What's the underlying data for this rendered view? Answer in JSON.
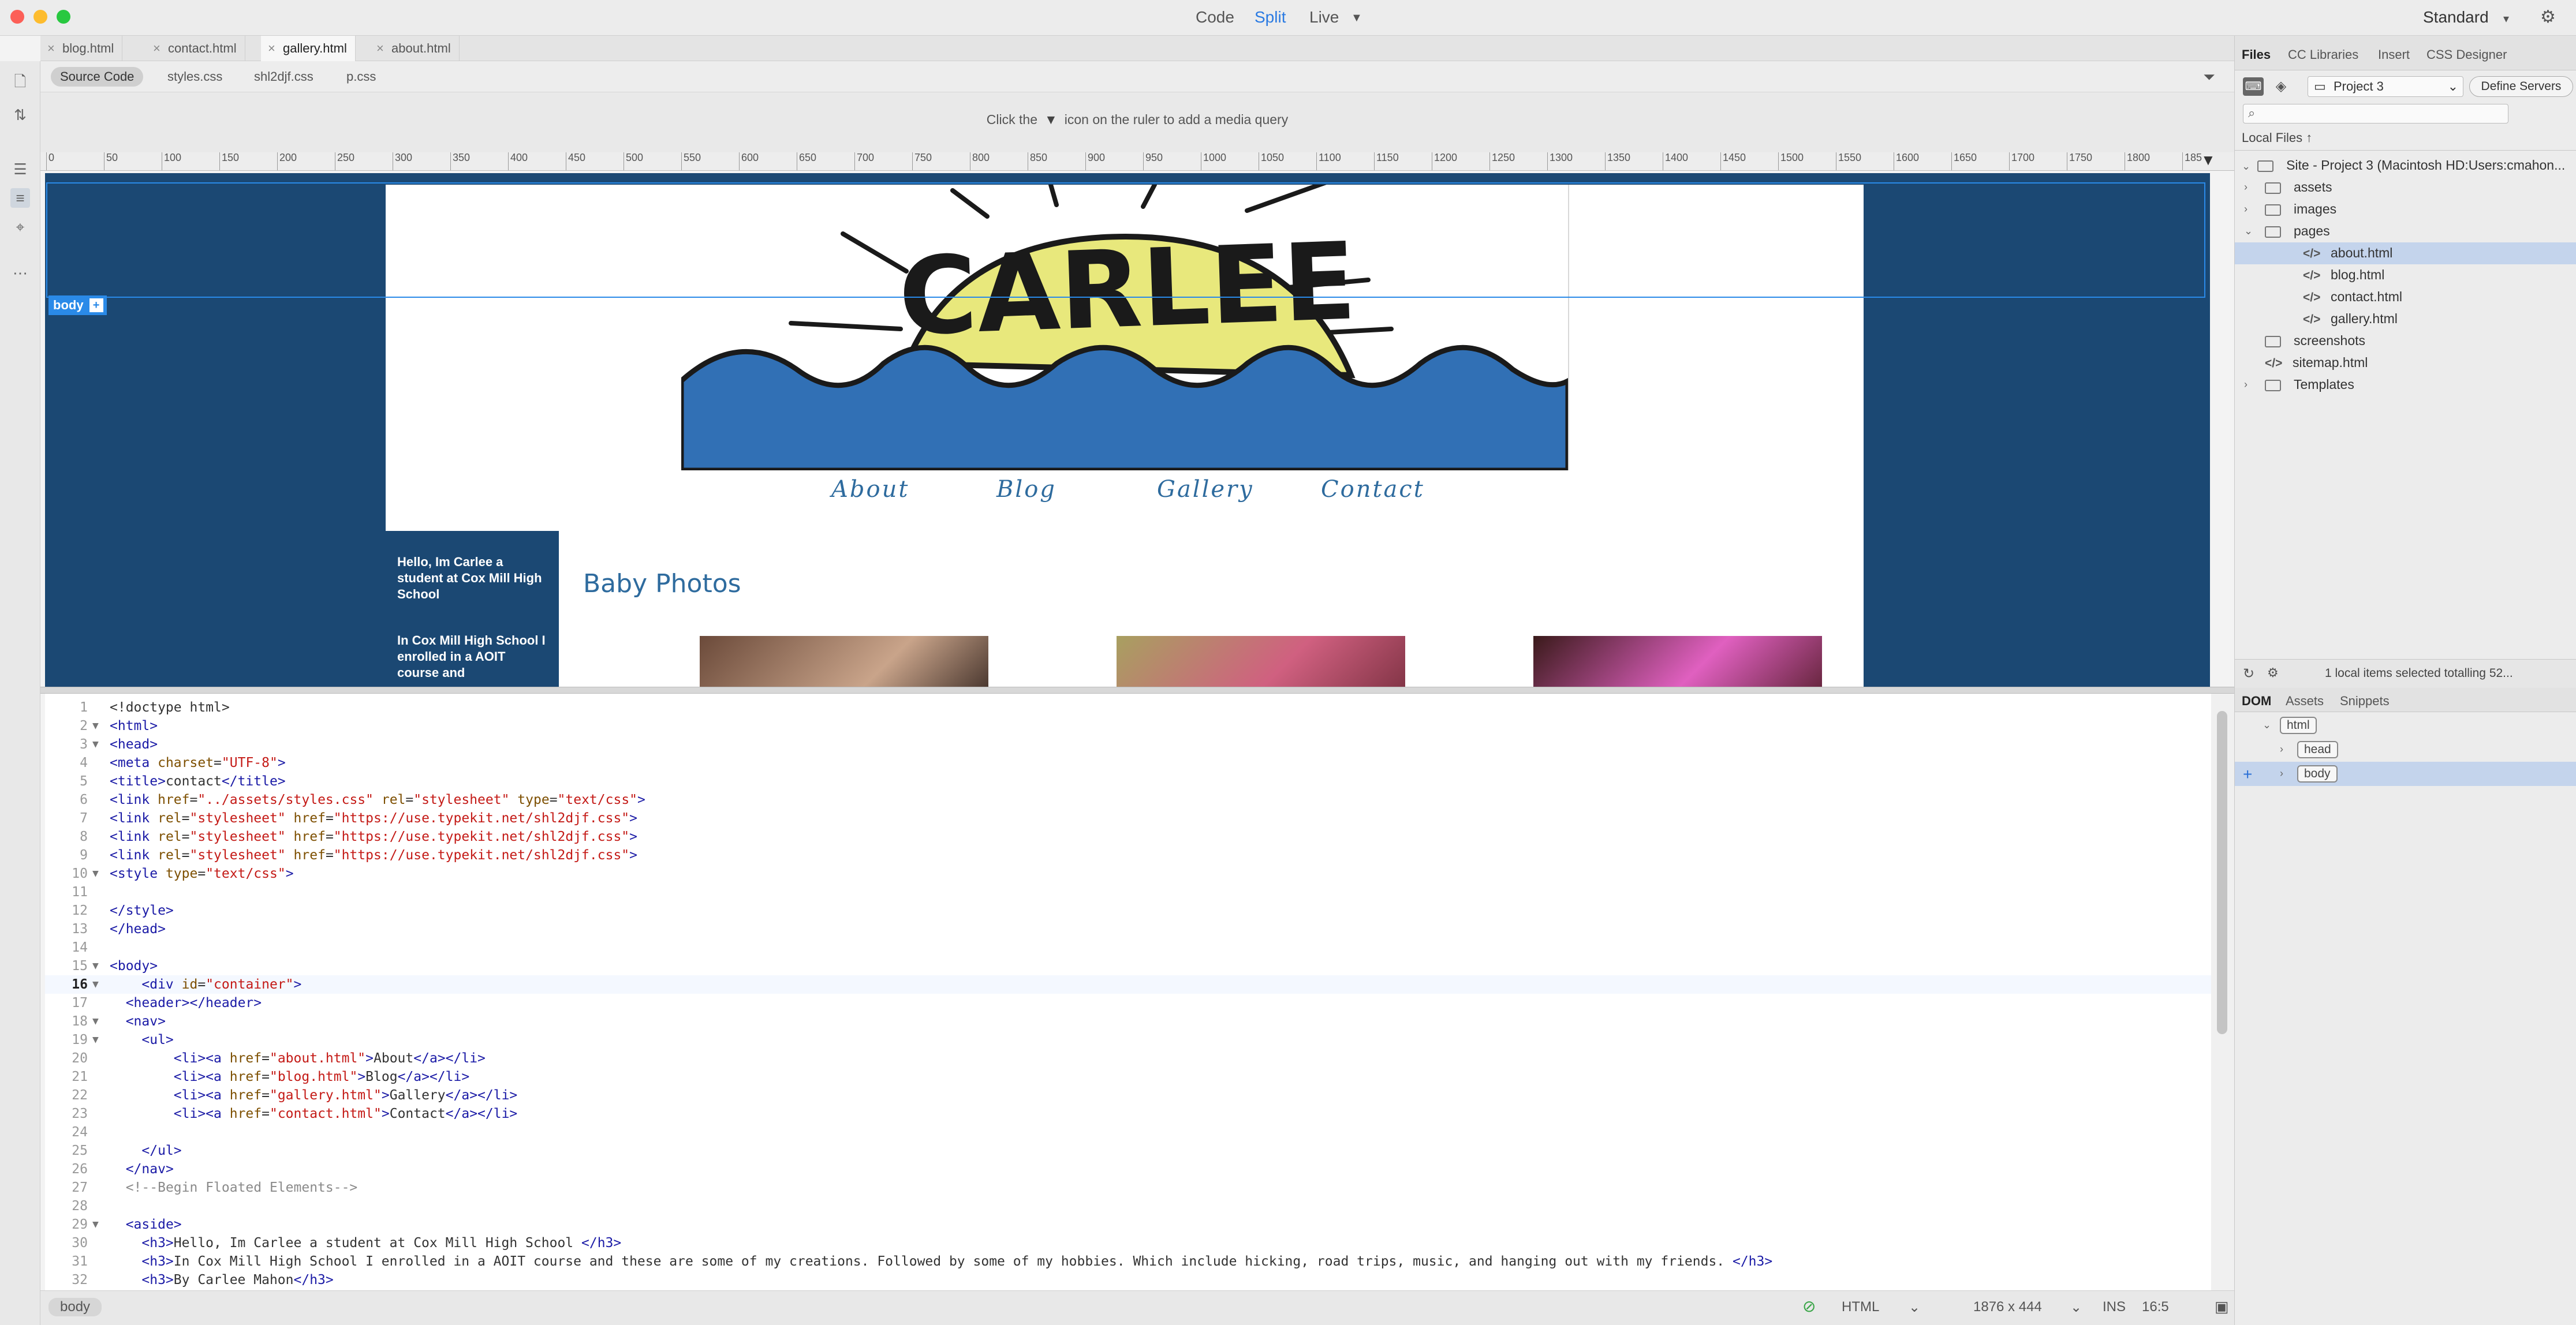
{
  "titlebar": {
    "views": [
      "Code",
      "Split",
      "Live"
    ],
    "active_view": "Split",
    "workspace": "Standard"
  },
  "doc_tabs": [
    "blog.html",
    "contact.html",
    "gallery.html",
    "about.html"
  ],
  "related_files": [
    "Source Code",
    "styles.css",
    "shl2djf.css",
    "p.css"
  ],
  "media_query_hint": {
    "before": "Click the",
    "after": "icon on the ruler to add a media query"
  },
  "ruler_ticks": [
    "0",
    "50",
    "100",
    "150",
    "200",
    "250",
    "300",
    "350",
    "400",
    "450",
    "500",
    "550",
    "600",
    "650",
    "700",
    "750",
    "800",
    "850",
    "900",
    "950",
    "1000",
    "1050",
    "1100",
    "1150",
    "1200",
    "1250",
    "1300",
    "1350",
    "1400",
    "1450",
    "1500",
    "1550",
    "1600",
    "1650",
    "1700",
    "1750",
    "1800",
    "185"
  ],
  "live": {
    "logo_text": "CARLEE",
    "nav": [
      "About",
      "Blog",
      "Gallery",
      "Contact"
    ],
    "aside_p1": "Hello, Im Carlee a student at Cox Mill High School",
    "aside_p2": "In Cox Mill High School I enrolled in a AOIT course and",
    "section_title": "Baby Photos",
    "body_tag": "body"
  },
  "code_lines": [
    {
      "n": "1",
      "fold": "",
      "html": "&lt;!doctype html&gt;"
    },
    {
      "n": "2",
      "fold": "▼",
      "html": "<span class='t'>&lt;html&gt;</span>"
    },
    {
      "n": "3",
      "fold": "▼",
      "html": "<span class='t'>&lt;head&gt;</span>"
    },
    {
      "n": "4",
      "fold": "",
      "html": "<span class='t'>&lt;meta</span> <span class='an'>charset</span>=<span class='av'>\"UTF-8\"</span><span class='t'>&gt;</span>"
    },
    {
      "n": "5",
      "fold": "",
      "html": "<span class='t'>&lt;title&gt;</span>contact<span class='t'>&lt;/title&gt;</span>"
    },
    {
      "n": "6",
      "fold": "",
      "html": "<span class='t'>&lt;link</span> <span class='an'>href</span>=<span class='av'>\"../assets/styles.css\"</span> <span class='an'>rel</span>=<span class='av'>\"stylesheet\"</span> <span class='an'>type</span>=<span class='av'>\"text/css\"</span><span class='t'>&gt;</span>"
    },
    {
      "n": "7",
      "fold": "",
      "html": "<span class='t'>&lt;link</span> <span class='an'>rel</span>=<span class='av'>\"stylesheet\"</span> <span class='an'>href</span>=<span class='av'>\"https://use.typekit.net/shl2djf.css\"</span><span class='t'>&gt;</span>"
    },
    {
      "n": "8",
      "fold": "",
      "html": "<span class='t'>&lt;link</span> <span class='an'>rel</span>=<span class='av'>\"stylesheet\"</span> <span class='an'>href</span>=<span class='av'>\"https://use.typekit.net/shl2djf.css\"</span><span class='t'>&gt;</span>"
    },
    {
      "n": "9",
      "fold": "",
      "html": "<span class='t'>&lt;link</span> <span class='an'>rel</span>=<span class='av'>\"stylesheet\"</span> <span class='an'>href</span>=<span class='av'>\"https://use.typekit.net/shl2djf.css\"</span><span class='t'>&gt;</span>"
    },
    {
      "n": "10",
      "fold": "▼",
      "html": "<span class='t'>&lt;style</span> <span class='an'>type</span>=<span class='av'>\"text/css\"</span><span class='t'>&gt;</span>"
    },
    {
      "n": "11",
      "fold": "",
      "html": ""
    },
    {
      "n": "12",
      "fold": "",
      "html": "<span class='t'>&lt;/style&gt;</span>"
    },
    {
      "n": "13",
      "fold": "",
      "html": "<span class='t'>&lt;/head&gt;</span>"
    },
    {
      "n": "14",
      "fold": "",
      "html": ""
    },
    {
      "n": "15",
      "fold": "▼",
      "html": "<span class='t'>&lt;body&gt;</span>"
    },
    {
      "n": "16",
      "fold": "▼",
      "html": "    <span class='t'>&lt;div</span> <span class='an'>id</span>=<span class='av'>\"container\"</span><span class='t'>&gt;</span>"
    },
    {
      "n": "17",
      "fold": "",
      "html": "  <span class='t'>&lt;header&gt;&lt;/header&gt;</span>"
    },
    {
      "n": "18",
      "fold": "▼",
      "html": "  <span class='t'>&lt;nav&gt;</span>"
    },
    {
      "n": "19",
      "fold": "▼",
      "html": "    <span class='t'>&lt;ul&gt;</span>"
    },
    {
      "n": "20",
      "fold": "",
      "html": "        <span class='t'>&lt;li&gt;&lt;a</span> <span class='an'>href</span>=<span class='av'>\"about.html\"</span><span class='t'>&gt;</span>About<span class='t'>&lt;/a&gt;&lt;/li&gt;</span>"
    },
    {
      "n": "21",
      "fold": "",
      "html": "        <span class='t'>&lt;li&gt;&lt;a</span> <span class='an'>href</span>=<span class='av'>\"blog.html\"</span><span class='t'>&gt;</span>Blog<span class='t'>&lt;/a&gt;&lt;/li&gt;</span>"
    },
    {
      "n": "22",
      "fold": "",
      "html": "        <span class='t'>&lt;li&gt;&lt;a</span> <span class='an'>href</span>=<span class='av'>\"gallery.html\"</span><span class='t'>&gt;</span>Gallery<span class='t'>&lt;/a&gt;&lt;/li&gt;</span>"
    },
    {
      "n": "23",
      "fold": "",
      "html": "        <span class='t'>&lt;li&gt;&lt;a</span> <span class='an'>href</span>=<span class='av'>\"contact.html\"</span><span class='t'>&gt;</span>Contact<span class='t'>&lt;/a&gt;&lt;/li&gt;</span>"
    },
    {
      "n": "24",
      "fold": "",
      "html": ""
    },
    {
      "n": "25",
      "fold": "",
      "html": "    <span class='t'>&lt;/ul&gt;</span>"
    },
    {
      "n": "26",
      "fold": "",
      "html": "  <span class='t'>&lt;/nav&gt;</span>"
    },
    {
      "n": "27",
      "fold": "",
      "html": "  <span class='cm'>&lt;!--Begin Floated Elements--&gt;</span>"
    },
    {
      "n": "28",
      "fold": "",
      "html": ""
    },
    {
      "n": "29",
      "fold": "▼",
      "html": "  <span class='t'>&lt;aside&gt;</span>"
    },
    {
      "n": "30",
      "fold": "",
      "html": "    <span class='t'>&lt;h3&gt;</span>Hello, Im Carlee a student at Cox Mill High School <span class='t'>&lt;/h3&gt;</span>"
    },
    {
      "n": "31",
      "fold": "",
      "html": "    <span class='t'>&lt;h3&gt;</span>In Cox Mill High School I enrolled in a AOIT course and these are some of my creations. Followed by some of my hobbies. Which include hicking, road trips, music, and hanging out with my friends. <span class='t'>&lt;/h3&gt;</span>"
    },
    {
      "n": "32",
      "fold": "",
      "html": "    <span class='t'>&lt;h3&gt;</span>By Carlee Mahon<span class='t'>&lt;/h3&gt;</span>"
    }
  ],
  "current_line": "16",
  "statusbar": {
    "tag": "body",
    "language": "HTML",
    "dims": "1876 x 444",
    "mode": "INS",
    "position": "16:5"
  },
  "files_panel": {
    "tabs": [
      "Files",
      "CC Libraries",
      "Insert",
      "CSS Designer"
    ],
    "site": "Project 3",
    "define_servers": "Define Servers",
    "local_files": "Local Files",
    "root": "Site - Project 3 (Macintosh HD:Users:cmahon...",
    "tree": [
      {
        "label": "assets",
        "kind": "folder",
        "depth": 1,
        "chev": "›"
      },
      {
        "label": "images",
        "kind": "folder",
        "depth": 1,
        "chev": "›"
      },
      {
        "label": "pages",
        "kind": "folder",
        "depth": 1,
        "chev": "⌄"
      },
      {
        "label": "about.html",
        "kind": "file",
        "depth": 2,
        "chev": ""
      },
      {
        "label": "blog.html",
        "kind": "file",
        "depth": 2,
        "chev": ""
      },
      {
        "label": "contact.html",
        "kind": "file",
        "depth": 2,
        "chev": ""
      },
      {
        "label": "gallery.html",
        "kind": "file",
        "depth": 2,
        "chev": ""
      },
      {
        "label": "screenshots",
        "kind": "folder",
        "depth": 1,
        "chev": ""
      },
      {
        "label": "sitemap.html",
        "kind": "file",
        "depth": 1,
        "chev": ""
      },
      {
        "label": "Templates",
        "kind": "folder",
        "depth": 1,
        "chev": "›"
      }
    ],
    "selected": "about.html",
    "status": "1 local items selected totalling 52..."
  },
  "dom_panel": {
    "tabs": [
      "DOM",
      "Assets",
      "Snippets"
    ],
    "nodes": [
      "html",
      "head",
      "body"
    ],
    "selected": "body"
  }
}
